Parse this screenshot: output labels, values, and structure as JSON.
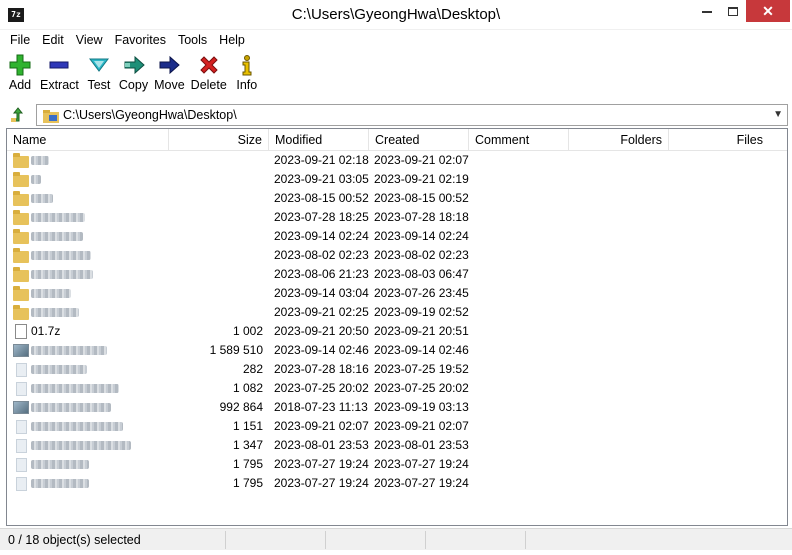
{
  "window": {
    "title": "C:\\Users\\GyeongHwa\\Desktop\\",
    "app_icon_text": "7z",
    "close_symbol": "✕"
  },
  "menu": [
    "File",
    "Edit",
    "View",
    "Favorites",
    "Tools",
    "Help"
  ],
  "toolbar": [
    {
      "label": "Add",
      "icon": "add-icon",
      "color": "#2fb32f"
    },
    {
      "label": "Extract",
      "icon": "extract-icon",
      "color": "#2f38b8"
    },
    {
      "label": "Test",
      "icon": "test-icon",
      "color": "#2bb8c8"
    },
    {
      "label": "Copy",
      "icon": "copy-icon",
      "color": "#1f8f78"
    },
    {
      "label": "Move",
      "icon": "move-icon",
      "color": "#1b2c8a"
    },
    {
      "label": "Delete",
      "icon": "delete-icon",
      "color": "#d42020"
    },
    {
      "label": "Info",
      "icon": "info-icon",
      "color": "#c8a400"
    }
  ],
  "address": {
    "path": "C:\\Users\\GyeongHwa\\Desktop\\"
  },
  "columns": [
    "Name",
    "Size",
    "Modified",
    "Created",
    "Comment",
    "Folders",
    "Files"
  ],
  "files": [
    {
      "type": "folder",
      "name": "",
      "size": "",
      "modified": "2023-09-21 02:18",
      "created": "2023-09-21 02:07"
    },
    {
      "type": "folder",
      "name": "",
      "size": "",
      "modified": "2023-09-21 03:05",
      "created": "2023-09-21 02:19"
    },
    {
      "type": "folder",
      "name": "",
      "size": "",
      "modified": "2023-08-15 00:52",
      "created": "2023-08-15 00:52"
    },
    {
      "type": "folder",
      "name": "",
      "size": "",
      "modified": "2023-07-28 18:25",
      "created": "2023-07-28 18:18"
    },
    {
      "type": "folder",
      "name": "",
      "size": "",
      "modified": "2023-09-14 02:24",
      "created": "2023-09-14 02:24"
    },
    {
      "type": "folder",
      "name": "",
      "size": "",
      "modified": "2023-08-02 02:23",
      "created": "2023-08-02 02:23"
    },
    {
      "type": "folder",
      "name": "",
      "size": "",
      "modified": "2023-08-06 21:23",
      "created": "2023-08-03 06:47"
    },
    {
      "type": "folder",
      "name": "",
      "size": "",
      "modified": "2023-09-14 03:04",
      "created": "2023-07-26 23:45"
    },
    {
      "type": "folder",
      "name": "",
      "size": "",
      "modified": "2023-09-21 02:25",
      "created": "2023-09-19 02:52"
    },
    {
      "type": "file",
      "name": "01.7z",
      "size": "1 002",
      "modified": "2023-09-21 20:50",
      "created": "2023-09-21 20:51"
    },
    {
      "type": "image",
      "name": "",
      "size": "1 589 510",
      "modified": "2023-09-14 02:46",
      "created": "2023-09-14 02:46"
    },
    {
      "type": "doc",
      "name": "",
      "size": "282",
      "modified": "2023-07-28 18:16",
      "created": "2023-07-25 19:52"
    },
    {
      "type": "doc",
      "name": "",
      "size": "1 082",
      "modified": "2023-07-25 20:02",
      "created": "2023-07-25 20:02"
    },
    {
      "type": "image",
      "name": "",
      "size": "992 864",
      "modified": "2018-07-23 11:13",
      "created": "2023-09-19 03:13"
    },
    {
      "type": "doc",
      "name": "",
      "size": "1 151",
      "modified": "2023-09-21 02:07",
      "created": "2023-09-21 02:07"
    },
    {
      "type": "doc",
      "name": "",
      "size": "1 347",
      "modified": "2023-08-01 23:53",
      "created": "2023-08-01 23:53"
    },
    {
      "type": "doc",
      "name": "",
      "size": "1 795",
      "modified": "2023-07-27 19:24",
      "created": "2023-07-27 19:24"
    },
    {
      "type": "doc",
      "name": "",
      "size": "1 795",
      "modified": "2023-07-27 19:24",
      "created": "2023-07-27 19:24"
    }
  ],
  "status": {
    "selection": "0 / 18 object(s) selected"
  }
}
